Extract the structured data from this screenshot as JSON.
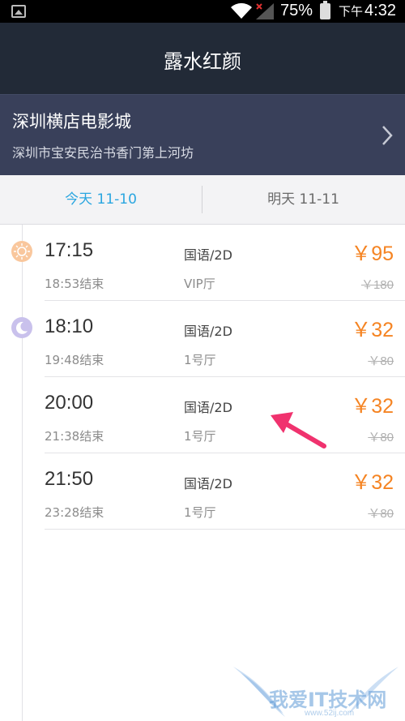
{
  "status_bar": {
    "battery": "75%",
    "ampm": "下午",
    "time": "4:32"
  },
  "header": {
    "title": "露水红颜"
  },
  "cinema": {
    "name": "深圳横店电影城",
    "address": "深圳市宝安民治书香门第上河坊"
  },
  "tabs": [
    {
      "label": "今天 11-10",
      "active": true
    },
    {
      "label": "明天 11-11",
      "active": false
    }
  ],
  "showtimes": [
    {
      "icon": "sun-icon",
      "time": "17:15",
      "end": "18:53结束",
      "lang": "国语/2D",
      "hall": "VIP厅",
      "price": "￥95",
      "original": "￥180"
    },
    {
      "icon": "moon-icon",
      "time": "18:10",
      "end": "19:48结束",
      "lang": "国语/2D",
      "hall": "1号厅",
      "price": "￥32",
      "original": "￥80"
    },
    {
      "icon": "",
      "time": "20:00",
      "end": "21:38结束",
      "lang": "国语/2D",
      "hall": "1号厅",
      "price": "￥32",
      "original": "￥80"
    },
    {
      "icon": "",
      "time": "21:50",
      "end": "23:28结束",
      "lang": "国语/2D",
      "hall": "1号厅",
      "price": "￥32",
      "original": "￥80"
    }
  ],
  "watermark": {
    "text": "我爱IT技术网",
    "sub": "www.52ij.com"
  },
  "colors": {
    "accent_blue": "#2aa6e0",
    "price_orange": "#f58423",
    "header_dark": "#222a37",
    "cinema_bg": "#39405a",
    "annotation_pink": "#f0326e"
  }
}
